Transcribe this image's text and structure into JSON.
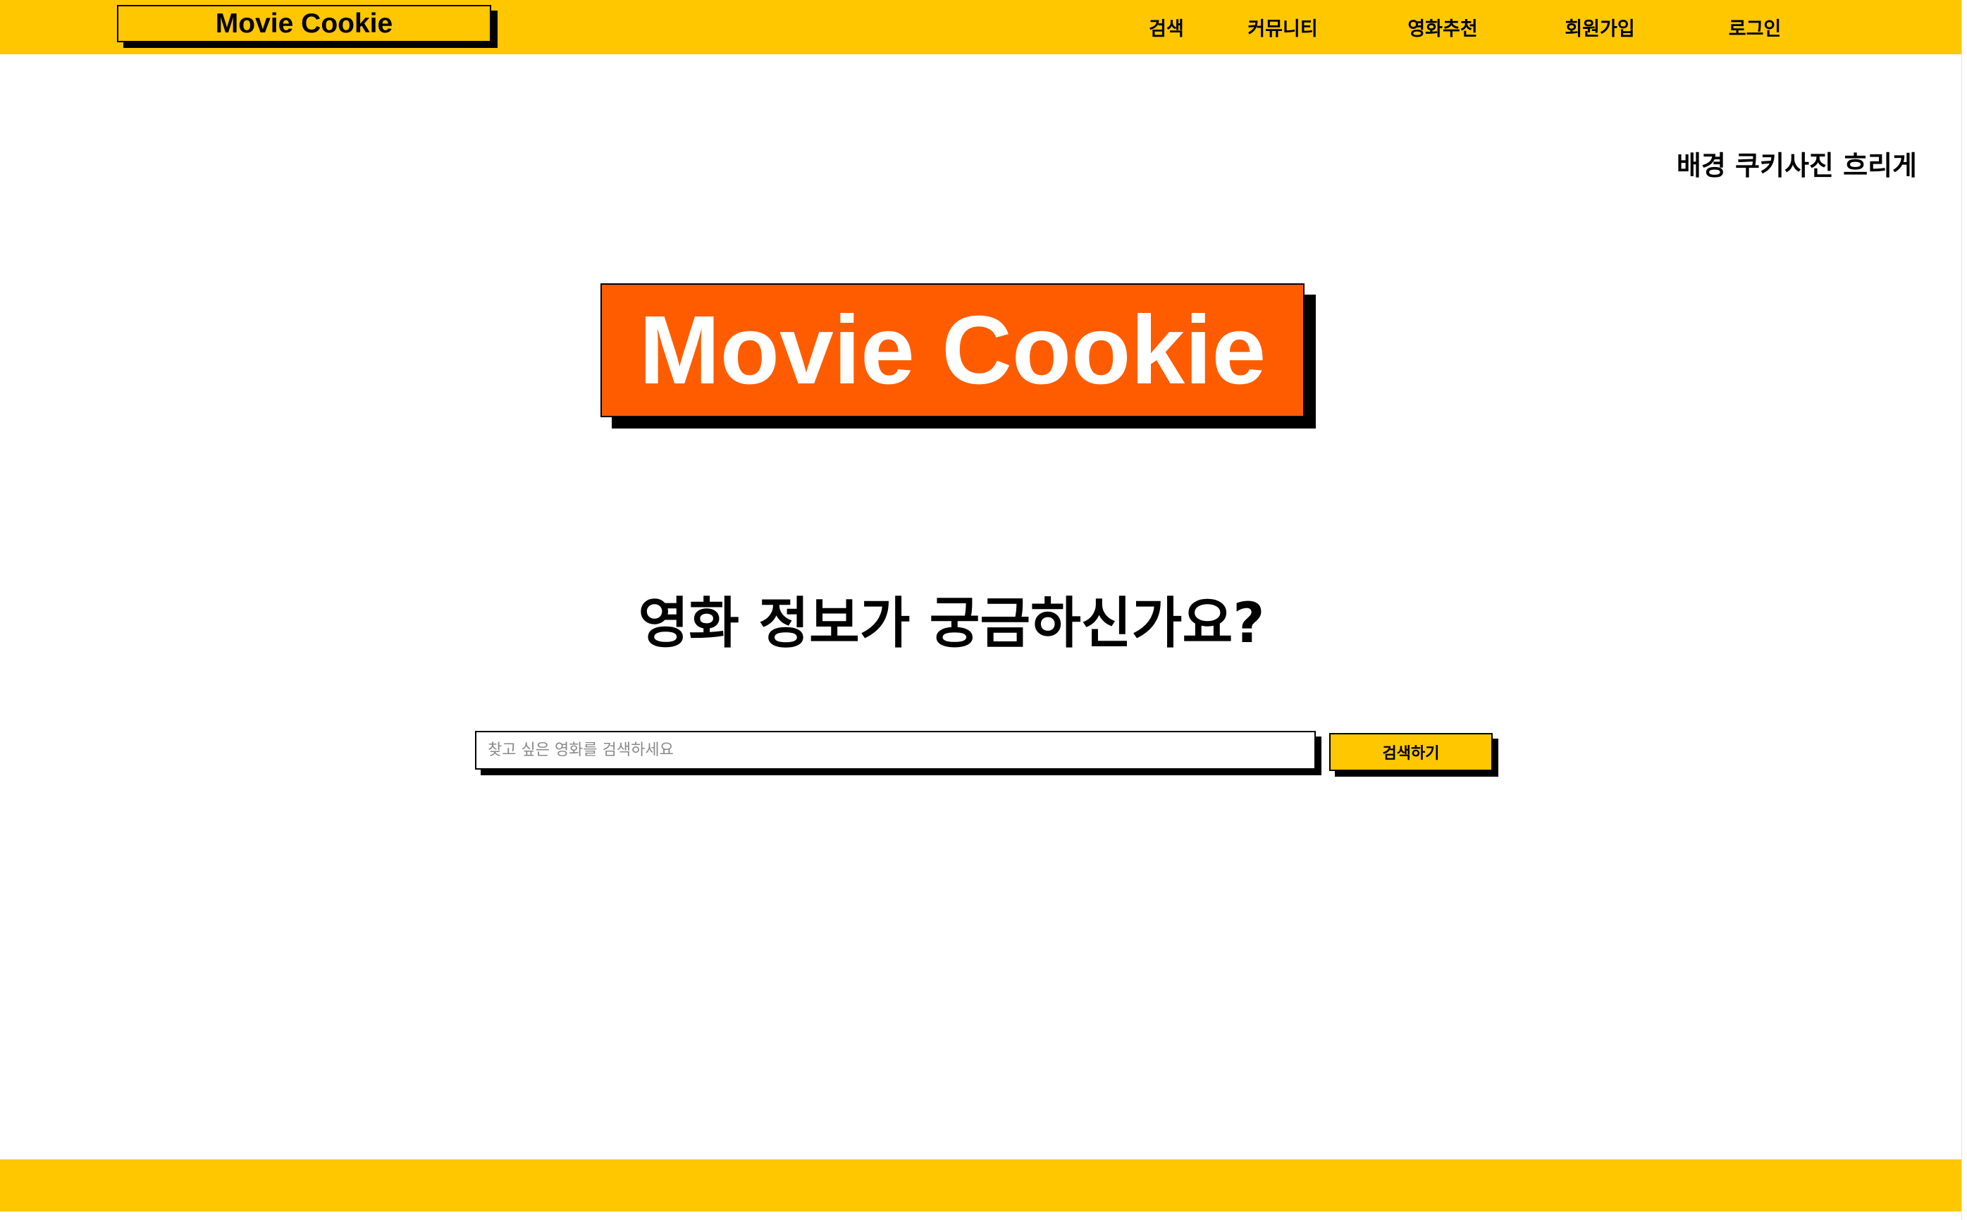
{
  "header": {
    "logo": "Movie Cookie",
    "nav": {
      "search": "검색",
      "community": "커뮤니티",
      "recommend": "영화추천",
      "signup": "회원가입",
      "login": "로그인"
    }
  },
  "background_note": "배경 쿠키사진 흐리게",
  "hero": {
    "logo": "Movie Cookie",
    "question": "영화 정보가 궁금하신가요?"
  },
  "search": {
    "placeholder": "찾고 싶은 영화를 검색하세요",
    "value": "",
    "button_label": "검색하기"
  },
  "colors": {
    "header_yellow": "#FFC700",
    "hero_orange": "#FF5C00",
    "text_black": "#000000",
    "hero_text_white": "#FFFFFF"
  }
}
